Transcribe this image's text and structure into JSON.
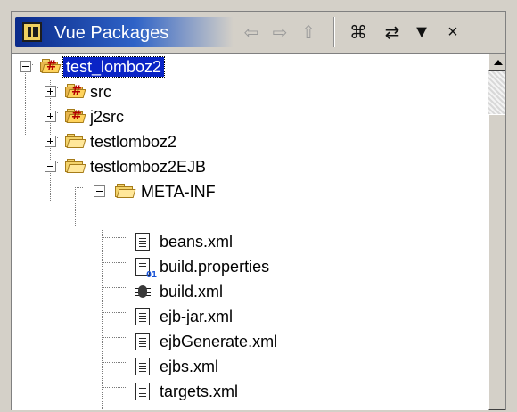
{
  "header": {
    "title": "Vue Packages",
    "toolbar": [
      {
        "name": "back-icon",
        "glyph": "⇦"
      },
      {
        "name": "forward-icon",
        "glyph": "⇨"
      },
      {
        "name": "up-icon",
        "glyph": "⇧"
      },
      {
        "name": "collapse-all-icon",
        "glyph": "⌘"
      },
      {
        "name": "link-icon",
        "glyph": "⇄"
      },
      {
        "name": "menu-icon",
        "glyph": "▼"
      },
      {
        "name": "close-icon",
        "glyph": "×"
      }
    ]
  },
  "tree": {
    "items": [
      {
        "label": "test_lomboz2",
        "type": "project",
        "expanded": true,
        "selected": true
      },
      {
        "label": "src",
        "type": "source-folder",
        "expanded": false
      },
      {
        "label": "j2src",
        "type": "source-folder",
        "expanded": false
      },
      {
        "label": "testlomboz2",
        "type": "folder",
        "expanded": false
      },
      {
        "label": "testlomboz2EJB",
        "type": "folder",
        "expanded": true
      },
      {
        "label": "META-INF",
        "type": "folder",
        "expanded": true
      },
      {
        "label": "beans.xml",
        "type": "file"
      },
      {
        "label": "build.properties",
        "type": "properties"
      },
      {
        "label": "build.xml",
        "type": "ant"
      },
      {
        "label": "ejb-jar.xml",
        "type": "file"
      },
      {
        "label": "ejbGenerate.xml",
        "type": "file"
      },
      {
        "label": "ejbs.xml",
        "type": "file"
      },
      {
        "label": "targets.xml",
        "type": "file"
      }
    ]
  },
  "colors": {
    "selection": "#0a24c6",
    "title_start": "#0a2a8a",
    "title_end": "#2f63c7",
    "folder": "#f3d36b"
  }
}
